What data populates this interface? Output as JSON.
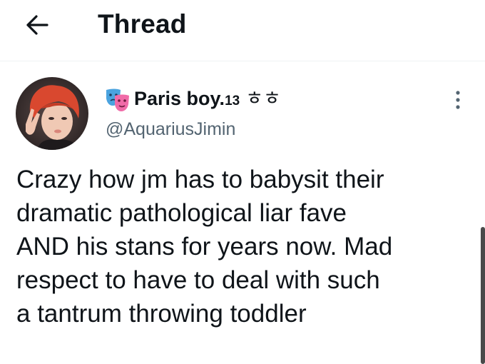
{
  "header": {
    "back_icon": "arrow-left-icon",
    "title": "Thread"
  },
  "tweet": {
    "author": {
      "badge_icon": "performing-arts-masks-icon",
      "name": "Paris boy.",
      "name_suffix": "13",
      "name_extra": "ㅎㅎ",
      "handle": "@AquariusJimin"
    },
    "more_icon": "more-vertical-icon",
    "text_lines": [
      "Crazy how jm has to babysit their",
      "dramatic pathological liar fave",
      "AND his stans for years now. Mad",
      "respect to have to deal with such",
      "a tantrum throwing toddler"
    ]
  },
  "colors": {
    "text": "#0f1419",
    "secondary": "#536471",
    "divider": "#eff3f4",
    "avatar_hair": "#d9482f",
    "mask_blue": "#4aa3df",
    "mask_pink": "#f06ba8"
  }
}
